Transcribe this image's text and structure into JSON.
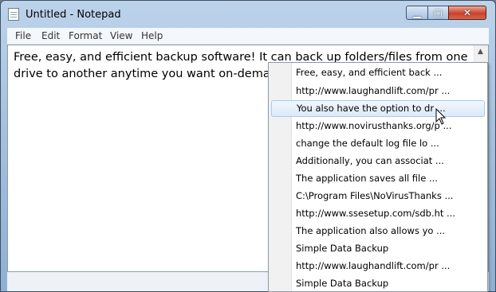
{
  "window": {
    "title": "Untitled - Notepad"
  },
  "menu": [
    "File",
    "Edit",
    "Format",
    "View",
    "Help"
  ],
  "editor": {
    "line1": "Free, easy, and efficient backup software! It can back up folders/files from one",
    "line2": "drive to another anytime you want on-demand"
  },
  "popup": {
    "selected_index": 2,
    "items": [
      "Free, easy, and efficient back ...",
      "http://www.laughandlift.com/pr ...",
      "You also have the option to dr ...",
      "http://www.novirusthanks.org/p ...",
      "change the default log file lo ...",
      "Additionally, you can associat ...",
      "The application saves all file ...",
      "C:\\Program Files\\NoVirusThanks ...",
      "http://www.ssesetup.com/sdb.ht ...",
      "The application also allows yo ...",
      "Simple Data Backup",
      "http://www.laughandlift.com/pr ...",
      "Simple Data Backup"
    ]
  },
  "icons": {
    "app": "notepad-icon",
    "minimize": "minimize-icon",
    "maximize": "maximize-icon",
    "close": "close-icon",
    "cursor": "mouse-pointer-icon"
  },
  "colors": {
    "selection_border": "#a9c9f0",
    "close_button": "#c8432b"
  }
}
